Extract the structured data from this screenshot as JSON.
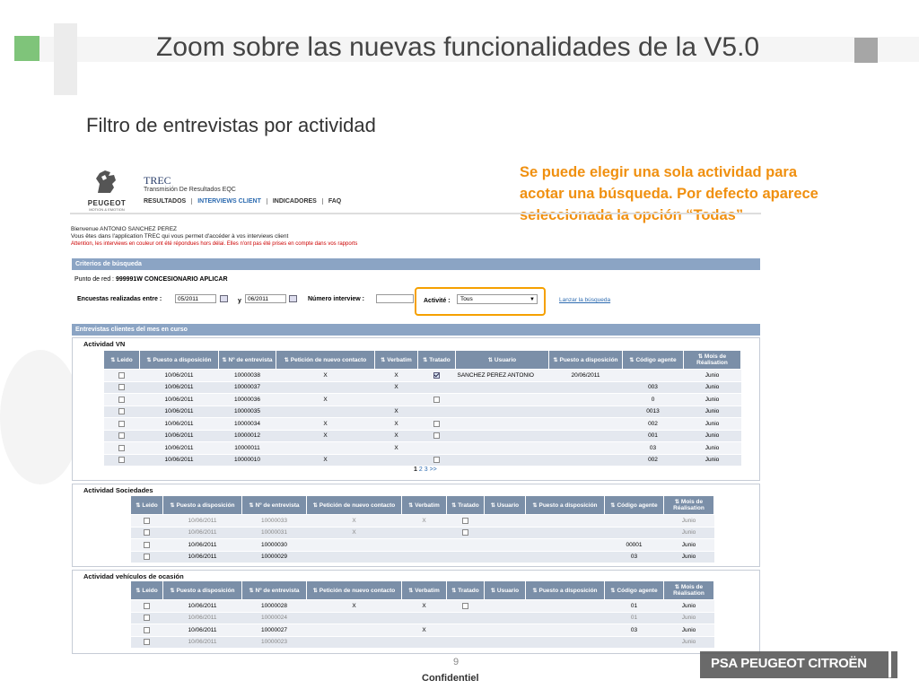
{
  "slide": {
    "title": "Zoom sobre las nuevas funcionalidades de la V5.0",
    "subtitle": "Filtro de entrevistas por actividad",
    "callout": "Se puede elegir una sola actividad para acotar una búsqueda. Por defecto aparece seleccionada la opción “Todas”",
    "page_number": "9",
    "confidential": "Confidentiel",
    "company": "PSA PEUGEOT CITROËN",
    "accent_color": "#f5a000"
  },
  "app": {
    "logo_brand": "PEUGEOT",
    "logo_tagline": "MOTION & EMOTION",
    "title": "TREC",
    "subtitle": "Transmisión De Resultados EQC",
    "nav": [
      "RESULTADOS",
      "INTERVIEWS CLIENT",
      "INDICADORES",
      "FAQ"
    ],
    "welcome_line1": "Bienvenue ANTONIO SANCHEZ PEREZ",
    "welcome_line2": "Vous êtes dans l'application TREC qui vous permet d'accéder à vos interviews client",
    "welcome_line3": "Attention, les interviews en couleur ont été répondues hors délai. Elles n'ont pas été prises en compte dans vos rapports",
    "criteria_header": "Criterios de búsqueda",
    "punto_red_label": "Punto de red :",
    "punto_red_value": "999991W  CONCESIONARIO APLICAR",
    "encuestas_label": "Encuestas realizadas entre :",
    "date_from": "05/2011",
    "y_label": "y",
    "date_to": "06/2011",
    "numero_label": "Número interview :",
    "numero_value": "",
    "activite_label": "Activité :",
    "activite_value": "Tous",
    "lanzar_label": "Lanzar la búsqueda",
    "results_header": "Entrevistas clientes del mes en curso",
    "pager": {
      "current": "1",
      "pages": [
        "2",
        "3"
      ],
      "next": ">>"
    }
  },
  "sections": [
    {
      "title": "Actividad VN",
      "columns": [
        "Leido",
        "Puesto a disposición",
        "Nº de entrevista",
        "Petición de nuevo contacto",
        "Verbatim",
        "Tratado",
        "Usuario",
        "Puesto a disposición",
        "Código agente",
        "Mois de Réalisation"
      ],
      "rows": [
        {
          "fecha": "10/06/2011",
          "num": "10000038",
          "peticion": "X",
          "verbatim": "X",
          "tratado": "checked",
          "usuario": "SANCHEZ PEREZ ANTONIO",
          "puesto2": "20/06/2011",
          "codigo": "",
          "mes": "Junio",
          "gray": false
        },
        {
          "fecha": "10/06/2011",
          "num": "10000037",
          "peticion": "",
          "verbatim": "X",
          "tratado": "",
          "usuario": "",
          "puesto2": "",
          "codigo": "003",
          "mes": "Junio",
          "gray": false
        },
        {
          "fecha": "10/06/2011",
          "num": "10000036",
          "peticion": "X",
          "verbatim": "",
          "tratado": "box",
          "usuario": "",
          "puesto2": "",
          "codigo": "0",
          "mes": "Junio",
          "gray": false
        },
        {
          "fecha": "10/06/2011",
          "num": "10000035",
          "peticion": "",
          "verbatim": "X",
          "tratado": "",
          "usuario": "",
          "puesto2": "",
          "codigo": "0013",
          "mes": "Junio",
          "gray": false
        },
        {
          "fecha": "10/06/2011",
          "num": "10000034",
          "peticion": "X",
          "verbatim": "X",
          "tratado": "box",
          "usuario": "",
          "puesto2": "",
          "codigo": "002",
          "mes": "Junio",
          "gray": false
        },
        {
          "fecha": "10/06/2011",
          "num": "10000012",
          "peticion": "X",
          "verbatim": "X",
          "tratado": "box",
          "usuario": "",
          "puesto2": "",
          "codigo": "001",
          "mes": "Junio",
          "gray": false
        },
        {
          "fecha": "10/06/2011",
          "num": "10000011",
          "peticion": "",
          "verbatim": "X",
          "tratado": "",
          "usuario": "",
          "puesto2": "",
          "codigo": "03",
          "mes": "Junio",
          "gray": false
        },
        {
          "fecha": "10/06/2011",
          "num": "10000010",
          "peticion": "X",
          "verbatim": "",
          "tratado": "box",
          "usuario": "",
          "puesto2": "",
          "codigo": "002",
          "mes": "Junio",
          "gray": false
        }
      ]
    },
    {
      "title": "Actividad Sociedades",
      "columns": [
        "Leido",
        "Puesto a disposición",
        "Nº de entrevista",
        "Petición de nuevo contacto",
        "Verbatim",
        "Tratado",
        "Usuario",
        "Puesto a disposición",
        "Código agente",
        "Mois de Réalisation"
      ],
      "rows": [
        {
          "fecha": "10/06/2011",
          "num": "10000033",
          "peticion": "X",
          "verbatim": "X",
          "tratado": "box",
          "usuario": "",
          "puesto2": "",
          "codigo": "",
          "mes": "Junio",
          "gray": true
        },
        {
          "fecha": "10/06/2011",
          "num": "10000031",
          "peticion": "X",
          "verbatim": "",
          "tratado": "box",
          "usuario": "",
          "puesto2": "",
          "codigo": "",
          "mes": "Junio",
          "gray": true
        },
        {
          "fecha": "10/06/2011",
          "num": "10000030",
          "peticion": "",
          "verbatim": "",
          "tratado": "",
          "usuario": "",
          "puesto2": "",
          "codigo": "00001",
          "mes": "Junio",
          "gray": false
        },
        {
          "fecha": "10/06/2011",
          "num": "10000029",
          "peticion": "",
          "verbatim": "",
          "tratado": "",
          "usuario": "",
          "puesto2": "",
          "codigo": "03",
          "mes": "Junio",
          "gray": false
        }
      ]
    },
    {
      "title": "Actividad vehículos de ocasión",
      "columns": [
        "Leido",
        "Puesto a disposición",
        "Nº de entrevista",
        "Petición de nuevo contacto",
        "Verbatim",
        "Tratado",
        "Usuario",
        "Puesto a disposición",
        "Código agente",
        "Mois de Réalisation"
      ],
      "rows": [
        {
          "fecha": "10/06/2011",
          "num": "10000028",
          "peticion": "X",
          "verbatim": "X",
          "tratado": "box",
          "usuario": "",
          "puesto2": "",
          "codigo": "01",
          "mes": "Junio",
          "gray": false
        },
        {
          "fecha": "10/06/2011",
          "num": "10000024",
          "peticion": "",
          "verbatim": "",
          "tratado": "",
          "usuario": "",
          "puesto2": "",
          "codigo": "01",
          "mes": "Junio",
          "gray": true
        },
        {
          "fecha": "10/06/2011",
          "num": "10000027",
          "peticion": "",
          "verbatim": "X",
          "tratado": "",
          "usuario": "",
          "puesto2": "",
          "codigo": "03",
          "mes": "Junio",
          "gray": false
        },
        {
          "fecha": "10/06/2011",
          "num": "10000023",
          "peticion": "",
          "verbatim": "",
          "tratado": "",
          "usuario": "",
          "puesto2": "",
          "codigo": "",
          "mes": "Junio",
          "gray": true
        }
      ]
    }
  ]
}
